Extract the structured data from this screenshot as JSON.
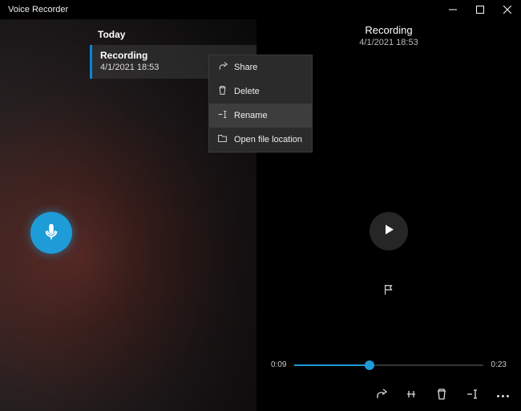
{
  "app": {
    "title": "Voice Recorder"
  },
  "sidebar": {
    "group_label": "Today",
    "items": [
      {
        "title": "Recording",
        "date": "4/1/2021 18:53"
      }
    ]
  },
  "context_menu": {
    "share": "Share",
    "delete": "Delete",
    "rename": "Rename",
    "open_location": "Open file location"
  },
  "detail": {
    "title": "Recording",
    "date": "4/1/2021 18:53",
    "current_time": "0:09",
    "duration": "0:23",
    "progress_percent": 40
  },
  "icons": {
    "record": "mic-icon",
    "play": "play-icon",
    "flag": "flag-icon",
    "share": "share-icon",
    "trim": "trim-icon",
    "delete": "trash-icon",
    "rename": "rename-icon",
    "more": "more-icon"
  },
  "colors": {
    "accent": "#1e9cd7"
  }
}
